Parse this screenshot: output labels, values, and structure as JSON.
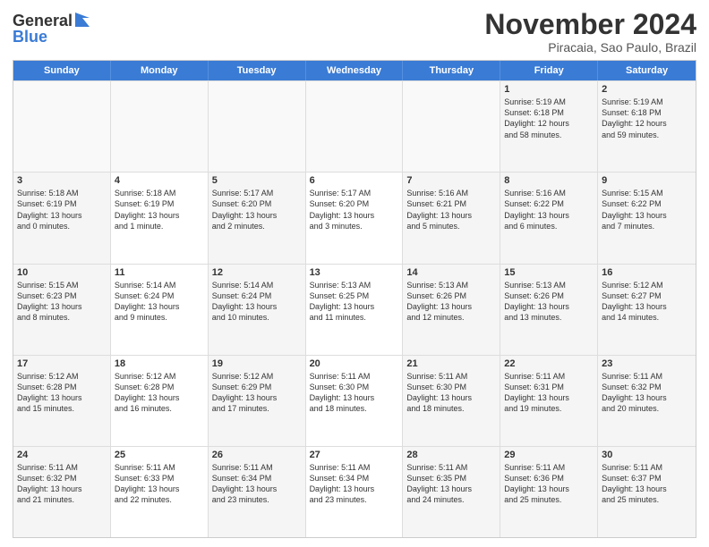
{
  "logo": {
    "line1": "General",
    "line2": "Blue"
  },
  "title": "November 2024",
  "subtitle": "Piracaia, Sao Paulo, Brazil",
  "header_days": [
    "Sunday",
    "Monday",
    "Tuesday",
    "Wednesday",
    "Thursday",
    "Friday",
    "Saturday"
  ],
  "rows": [
    [
      {
        "day": "",
        "text": "",
        "empty": true
      },
      {
        "day": "",
        "text": "",
        "empty": true
      },
      {
        "day": "",
        "text": "",
        "empty": true
      },
      {
        "day": "",
        "text": "",
        "empty": true
      },
      {
        "day": "",
        "text": "",
        "empty": true
      },
      {
        "day": "1",
        "text": "Sunrise: 5:19 AM\nSunset: 6:18 PM\nDaylight: 12 hours\nand 58 minutes.",
        "shaded": true
      },
      {
        "day": "2",
        "text": "Sunrise: 5:19 AM\nSunset: 6:18 PM\nDaylight: 12 hours\nand 59 minutes.",
        "shaded": true
      }
    ],
    [
      {
        "day": "3",
        "text": "Sunrise: 5:18 AM\nSunset: 6:19 PM\nDaylight: 13 hours\nand 0 minutes.",
        "shaded": true
      },
      {
        "day": "4",
        "text": "Sunrise: 5:18 AM\nSunset: 6:19 PM\nDaylight: 13 hours\nand 1 minute."
      },
      {
        "day": "5",
        "text": "Sunrise: 5:17 AM\nSunset: 6:20 PM\nDaylight: 13 hours\nand 2 minutes.",
        "shaded": true
      },
      {
        "day": "6",
        "text": "Sunrise: 5:17 AM\nSunset: 6:20 PM\nDaylight: 13 hours\nand 3 minutes."
      },
      {
        "day": "7",
        "text": "Sunrise: 5:16 AM\nSunset: 6:21 PM\nDaylight: 13 hours\nand 5 minutes.",
        "shaded": true
      },
      {
        "day": "8",
        "text": "Sunrise: 5:16 AM\nSunset: 6:22 PM\nDaylight: 13 hours\nand 6 minutes.",
        "shaded": true
      },
      {
        "day": "9",
        "text": "Sunrise: 5:15 AM\nSunset: 6:22 PM\nDaylight: 13 hours\nand 7 minutes.",
        "shaded": true
      }
    ],
    [
      {
        "day": "10",
        "text": "Sunrise: 5:15 AM\nSunset: 6:23 PM\nDaylight: 13 hours\nand 8 minutes.",
        "shaded": true
      },
      {
        "day": "11",
        "text": "Sunrise: 5:14 AM\nSunset: 6:24 PM\nDaylight: 13 hours\nand 9 minutes."
      },
      {
        "day": "12",
        "text": "Sunrise: 5:14 AM\nSunset: 6:24 PM\nDaylight: 13 hours\nand 10 minutes.",
        "shaded": true
      },
      {
        "day": "13",
        "text": "Sunrise: 5:13 AM\nSunset: 6:25 PM\nDaylight: 13 hours\nand 11 minutes."
      },
      {
        "day": "14",
        "text": "Sunrise: 5:13 AM\nSunset: 6:26 PM\nDaylight: 13 hours\nand 12 minutes.",
        "shaded": true
      },
      {
        "day": "15",
        "text": "Sunrise: 5:13 AM\nSunset: 6:26 PM\nDaylight: 13 hours\nand 13 minutes.",
        "shaded": true
      },
      {
        "day": "16",
        "text": "Sunrise: 5:12 AM\nSunset: 6:27 PM\nDaylight: 13 hours\nand 14 minutes.",
        "shaded": true
      }
    ],
    [
      {
        "day": "17",
        "text": "Sunrise: 5:12 AM\nSunset: 6:28 PM\nDaylight: 13 hours\nand 15 minutes.",
        "shaded": true
      },
      {
        "day": "18",
        "text": "Sunrise: 5:12 AM\nSunset: 6:28 PM\nDaylight: 13 hours\nand 16 minutes."
      },
      {
        "day": "19",
        "text": "Sunrise: 5:12 AM\nSunset: 6:29 PM\nDaylight: 13 hours\nand 17 minutes.",
        "shaded": true
      },
      {
        "day": "20",
        "text": "Sunrise: 5:11 AM\nSunset: 6:30 PM\nDaylight: 13 hours\nand 18 minutes."
      },
      {
        "day": "21",
        "text": "Sunrise: 5:11 AM\nSunset: 6:30 PM\nDaylight: 13 hours\nand 18 minutes.",
        "shaded": true
      },
      {
        "day": "22",
        "text": "Sunrise: 5:11 AM\nSunset: 6:31 PM\nDaylight: 13 hours\nand 19 minutes.",
        "shaded": true
      },
      {
        "day": "23",
        "text": "Sunrise: 5:11 AM\nSunset: 6:32 PM\nDaylight: 13 hours\nand 20 minutes.",
        "shaded": true
      }
    ],
    [
      {
        "day": "24",
        "text": "Sunrise: 5:11 AM\nSunset: 6:32 PM\nDaylight: 13 hours\nand 21 minutes.",
        "shaded": true
      },
      {
        "day": "25",
        "text": "Sunrise: 5:11 AM\nSunset: 6:33 PM\nDaylight: 13 hours\nand 22 minutes."
      },
      {
        "day": "26",
        "text": "Sunrise: 5:11 AM\nSunset: 6:34 PM\nDaylight: 13 hours\nand 23 minutes.",
        "shaded": true
      },
      {
        "day": "27",
        "text": "Sunrise: 5:11 AM\nSunset: 6:34 PM\nDaylight: 13 hours\nand 23 minutes."
      },
      {
        "day": "28",
        "text": "Sunrise: 5:11 AM\nSunset: 6:35 PM\nDaylight: 13 hours\nand 24 minutes.",
        "shaded": true
      },
      {
        "day": "29",
        "text": "Sunrise: 5:11 AM\nSunset: 6:36 PM\nDaylight: 13 hours\nand 25 minutes.",
        "shaded": true
      },
      {
        "day": "30",
        "text": "Sunrise: 5:11 AM\nSunset: 6:37 PM\nDaylight: 13 hours\nand 25 minutes.",
        "shaded": true
      }
    ]
  ]
}
